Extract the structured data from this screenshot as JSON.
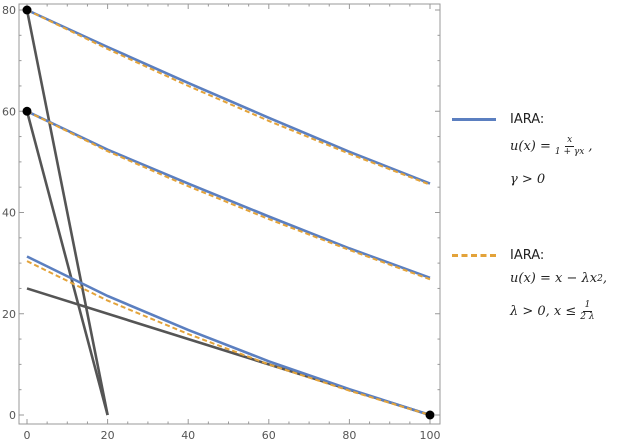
{
  "chart_data": {
    "type": "line",
    "xlim": [
      0,
      100
    ],
    "ylim": [
      0,
      80
    ],
    "xticks": [
      0,
      20,
      40,
      60,
      80,
      100
    ],
    "yticks": [
      0,
      20,
      40,
      60,
      80
    ],
    "grid": false,
    "legend_position": "right",
    "series": [
      {
        "name": "IARA",
        "style": "solid",
        "color": "#5b7fc0",
        "curves": [
          {
            "x": [
              0,
              20,
              40,
              60,
              80,
              100
            ],
            "y": [
              80,
              72.7,
              65.6,
              58.7,
              52.0,
              45.7
            ]
          },
          {
            "x": [
              0,
              20,
              40,
              60,
              80,
              100
            ],
            "y": [
              60,
              52.4,
              45.7,
              39.2,
              32.9,
              27.1
            ]
          },
          {
            "x": [
              0,
              20,
              40,
              60,
              80,
              100
            ],
            "y": [
              31.3,
              23.5,
              16.8,
              10.6,
              5.1,
              0
            ]
          }
        ]
      },
      {
        "name": "IARA",
        "style": "dashed",
        "color": "#e3a33a",
        "curves": [
          {
            "x": [
              0,
              20,
              40,
              60,
              80,
              100
            ],
            "y": [
              80,
              72.3,
              65.0,
              58.1,
              51.6,
              45.5
            ]
          },
          {
            "x": [
              0,
              20,
              40,
              60,
              80,
              100
            ],
            "y": [
              60,
              52.1,
              45.2,
              38.7,
              32.6,
              26.8
            ]
          },
          {
            "x": [
              0,
              20,
              40,
              60,
              80,
              100
            ],
            "y": [
              30.4,
              22.6,
              16.0,
              10.0,
              4.8,
              0
            ]
          }
        ]
      }
    ],
    "reference_lines": [
      {
        "x": [
          0,
          20
        ],
        "y": [
          80,
          0
        ]
      },
      {
        "x": [
          0,
          20
        ],
        "y": [
          60,
          0
        ]
      },
      {
        "x": [
          0,
          100
        ],
        "y": [
          25,
          0
        ]
      }
    ],
    "points": [
      {
        "x": 0,
        "y": 80
      },
      {
        "x": 0,
        "y": 60
      },
      {
        "x": 100,
        "y": 0
      }
    ]
  },
  "legend": {
    "item1": {
      "title": "IARA:",
      "formula_lhs": "u(x) =",
      "formula_num": "x",
      "formula_den": "1 + γx",
      "formula_tail": ",",
      "condition": "γ > 0"
    },
    "item2": {
      "title": "IARA:",
      "formula": "u(x) = x − λx",
      "formula_sup": "2",
      "formula_tail": ",",
      "condition_lhs": "λ > 0, x ≤",
      "condition_num": "1",
      "condition_den": "2 λ"
    }
  },
  "colors": {
    "axis": "#999999",
    "reference": "#555555",
    "point": "#000000"
  }
}
